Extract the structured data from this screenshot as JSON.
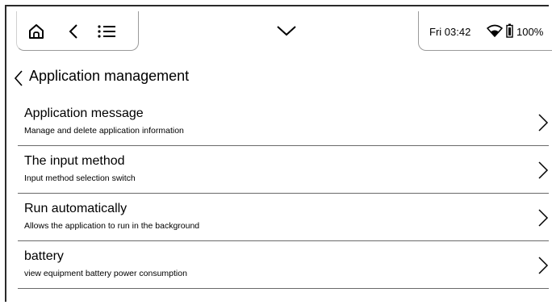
{
  "statusbar": {
    "time": "Fri 03:42",
    "battery": "100%",
    "icons": [
      "home-icon",
      "back-icon",
      "menu-list-icon",
      "chevron-down-icon",
      "wifi-icon",
      "battery-icon"
    ]
  },
  "page": {
    "title": "Application management"
  },
  "items": [
    {
      "title": "Application message",
      "subtitle": "Manage and delete application information"
    },
    {
      "title": "The input method",
      "subtitle": "Input method selection switch"
    },
    {
      "title": "Run automatically",
      "subtitle": "Allows the application to run in the background"
    },
    {
      "title": "battery",
      "subtitle": "view equipment battery power consumption"
    }
  ]
}
